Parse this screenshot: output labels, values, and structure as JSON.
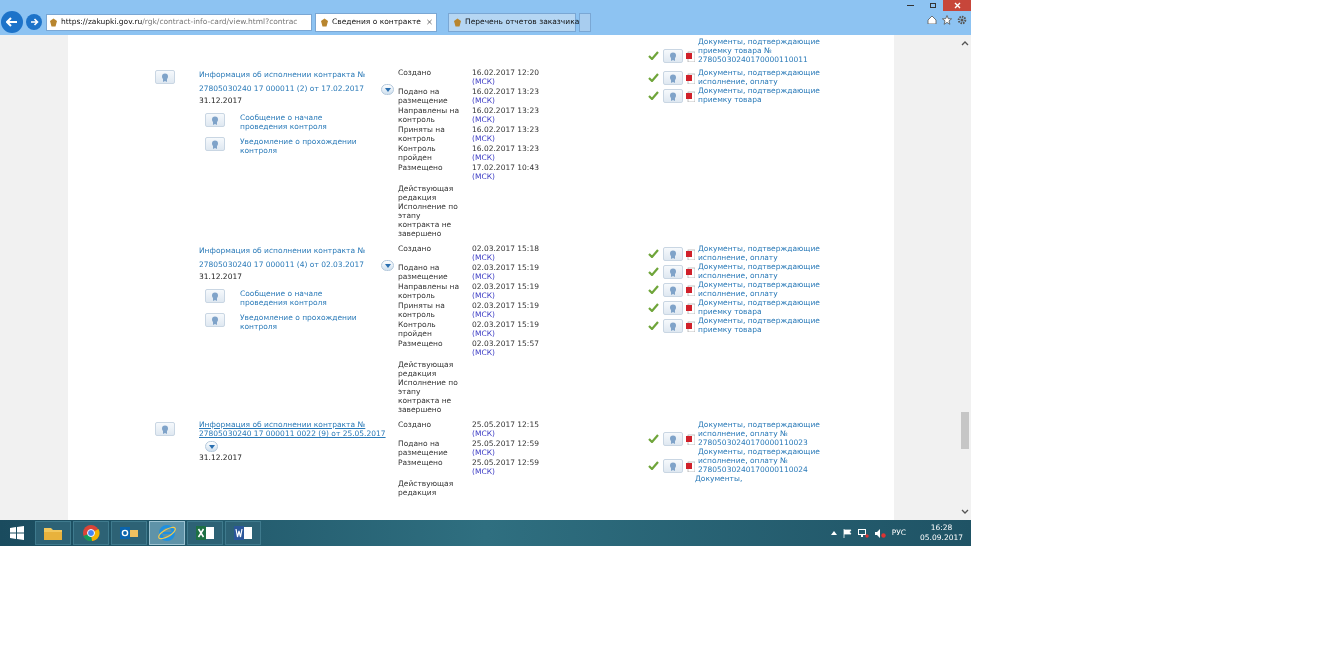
{
  "browser": {
    "url_host": "https://zakupki.gov.ru",
    "url_path": "/rgk/contract-info-card/view.html?contrac",
    "tabs": [
      {
        "label": "Сведения о контракте",
        "selected": true
      },
      {
        "label": "Перечень отчетов заказчика",
        "selected": false
      }
    ]
  },
  "records": [
    {
      "has_icon": false,
      "documents": [
        {
          "text": "Документы, подтверждающие приемку товара № 27805030240170000110011",
          "verified": true
        }
      ]
    },
    {
      "has_icon": true,
      "title": "Информация об исполнении контракта № 27805030240 17 000011 (2) от 17.02.2017",
      "underlined": false,
      "end_date": "31.12.2017",
      "subitems": [
        "Сообщение о начале проведения контроля",
        "Уведомление о прохождении контроля"
      ],
      "events": [
        {
          "label": "Создано",
          "date": "16.02.2017 12:20",
          "tz": "(МСК)"
        },
        {
          "label": "Подано на размещение",
          "date": "16.02.2017 13:23",
          "tz": "(МСК)"
        },
        {
          "label": "Направлены на контроль",
          "date": "16.02.2017 13:23",
          "tz": "(МСК)"
        },
        {
          "label": "Приняты на контроль",
          "date": "16.02.2017 13:23",
          "tz": "(МСК)"
        },
        {
          "label": "Контроль пройден",
          "date": "16.02.2017 13:23",
          "tz": "(МСК)"
        },
        {
          "label": "Размещено",
          "date": "17.02.2017 10:43",
          "tz": "(МСК)"
        }
      ],
      "notes": [
        "Действующая редакция",
        "Исполнение по этапу контракта не завершено"
      ],
      "documents": [
        {
          "text": "Документы, подтверждающие исполнение, оплату",
          "verified": true
        },
        {
          "text": "Документы, подтверждающие приемку товара",
          "verified": true
        }
      ]
    },
    {
      "has_icon": false,
      "title": "Информация об исполнении контракта № 27805030240 17 000011 (4) от 02.03.2017",
      "underlined": false,
      "end_date": "31.12.2017",
      "subitems": [
        "Сообщение о начале проведения контроля",
        "Уведомление о прохождении контроля"
      ],
      "events": [
        {
          "label": "Создано",
          "date": "02.03.2017 15:18",
          "tz": "(МСК)"
        },
        {
          "label": "Подано на размещение",
          "date": "02.03.2017 15:19",
          "tz": "(МСК)"
        },
        {
          "label": "Направлены на контроль",
          "date": "02.03.2017 15:19",
          "tz": "(МСК)"
        },
        {
          "label": "Приняты на контроль",
          "date": "02.03.2017 15:19",
          "tz": "(МСК)"
        },
        {
          "label": "Контроль пройден",
          "date": "02.03.2017 15:19",
          "tz": "(МСК)"
        },
        {
          "label": "Размещено",
          "date": "02.03.2017 15:57",
          "tz": "(МСК)"
        }
      ],
      "notes": [
        "Действующая редакция",
        "Исполнение по этапу контракта не завершено"
      ],
      "documents": [
        {
          "text": "Документы, подтверждающие исполнение, оплату",
          "verified": true
        },
        {
          "text": "Документы, подтверждающие исполнение, оплату",
          "verified": true
        },
        {
          "text": "Документы, подтверждающие исполнение, оплату",
          "verified": true
        },
        {
          "text": "Документы, подтверждающие приемку товара",
          "verified": true
        },
        {
          "text": "Документы, подтверждающие приемку товара",
          "verified": true
        }
      ]
    },
    {
      "has_icon": true,
      "title": "Информация об исполнении контракта № 27805030240 17 000011 0022 (9) от 25.05.2017",
      "underlined": true,
      "end_date": "31.12.2017",
      "events": [
        {
          "label": "Создано",
          "date": "25.05.2017 12:15",
          "tz": "(МСК)"
        },
        {
          "label": "Подано на размещение",
          "date": "25.05.2017 12:59",
          "tz": "(МСК)"
        },
        {
          "label": "Размещено",
          "date": "25.05.2017 12:59",
          "tz": "(МСК)"
        }
      ],
      "notes": [
        "Действующая редакция"
      ],
      "documents": [
        {
          "text": "Документы, подтверждающие исполнение, оплату № 27805030240170000110023",
          "verified": true
        },
        {
          "text": "Документы, подтверждающие исполнение, оплату № 27805030240170000110024",
          "verified": true
        },
        {
          "text": "Документы,"
        }
      ]
    }
  ],
  "taskbar": {
    "apps": [
      {
        "kind": "explorer",
        "selected": false
      },
      {
        "kind": "chrome",
        "selected": false
      },
      {
        "kind": "outlook",
        "selected": false
      },
      {
        "kind": "ie",
        "selected": true
      },
      {
        "kind": "excel",
        "selected": false
      },
      {
        "kind": "word",
        "selected": false
      }
    ],
    "language": "РУС",
    "time": "16:28",
    "date": "05.09.2017"
  }
}
